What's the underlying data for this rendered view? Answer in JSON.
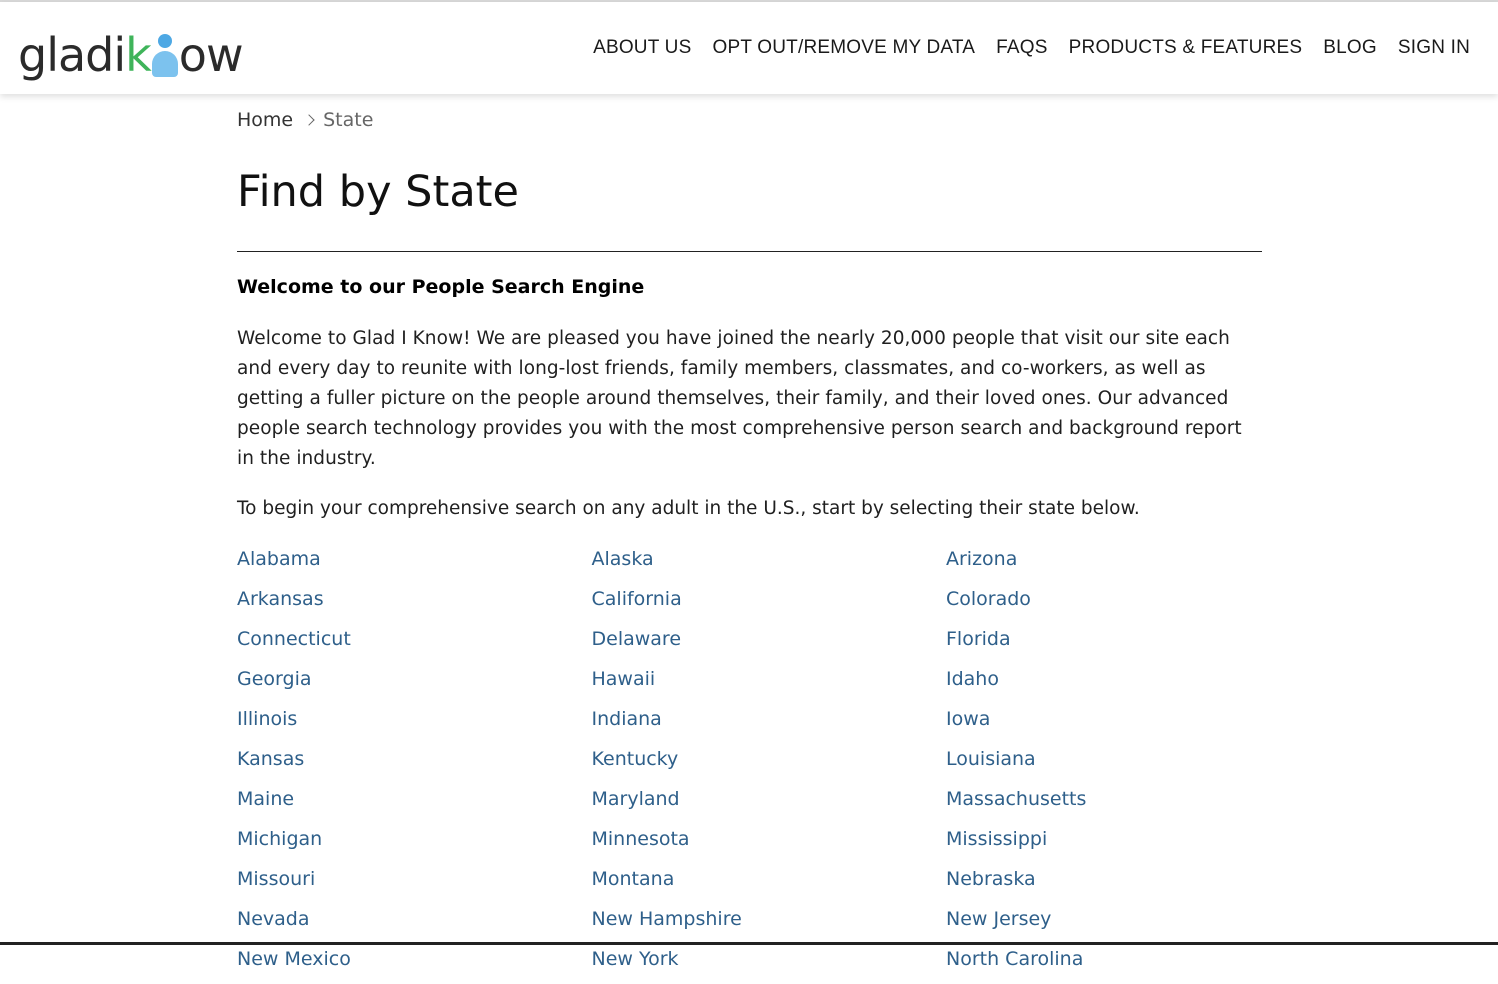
{
  "header": {
    "logo": {
      "text_left": "gladi",
      "text_green": "k",
      "text_right": "ow"
    },
    "nav": [
      {
        "label": "ABOUT US"
      },
      {
        "label": "OPT OUT/REMOVE MY DATA"
      },
      {
        "label": "FAQS"
      },
      {
        "label": "PRODUCTS & FEATURES"
      },
      {
        "label": "BLOG"
      },
      {
        "label": "SIGN IN"
      }
    ]
  },
  "breadcrumb": {
    "home": "Home",
    "current": "State"
  },
  "page_title": "Find by State",
  "intro": {
    "heading": "Welcome to our People Search Engine",
    "paragraph": "Welcome to Glad I Know! We are pleased you have joined the nearly 20,000 people that visit our site each and every day to reunite with long-lost friends, family members, classmates, and co-workers, as well as getting a fuller picture on the people around themselves, their family, and their loved ones. Our advanced people search technology provides you with the most comprehensive person search and background report in the industry.",
    "lead": "To begin your comprehensive search on any adult in the U.S., start by selecting their state below."
  },
  "states": [
    "Alabama",
    "Alaska",
    "Arizona",
    "Arkansas",
    "California",
    "Colorado",
    "Connecticut",
    "Delaware",
    "Florida",
    "Georgia",
    "Hawaii",
    "Idaho",
    "Illinois",
    "Indiana",
    "Iowa",
    "Kansas",
    "Kentucky",
    "Louisiana",
    "Maine",
    "Maryland",
    "Massachusetts",
    "Michigan",
    "Minnesota",
    "Mississippi",
    "Missouri",
    "Montana",
    "Nebraska",
    "Nevada",
    "New Hampshire",
    "New Jersey",
    "New Mexico",
    "New York",
    "North Carolina"
  ],
  "colors": {
    "link": "#2e5f8a",
    "logo_green": "#3fb45a",
    "logo_blue": "#7cc2ee"
  }
}
